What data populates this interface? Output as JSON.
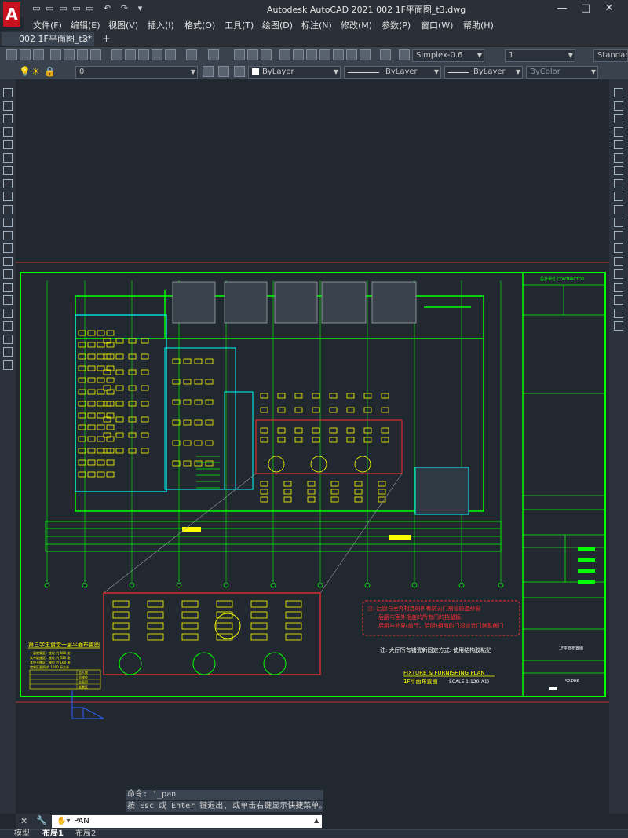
{
  "app": {
    "logo": "A",
    "title": "Autodesk AutoCAD 2021    002 1F平面图_t3.dwg"
  },
  "window_controls": {
    "minimize": "—",
    "maximize": "□",
    "close": "✕"
  },
  "menu": [
    "文件(F)",
    "编辑(E)",
    "视图(V)",
    "插入(I)",
    "格式(O)",
    "工具(T)",
    "绘图(D)",
    "标注(N)",
    "修改(M)",
    "参数(P)",
    "窗口(W)",
    "帮助(H)"
  ],
  "tabs": {
    "active": "002 1F平面图_t3*",
    "close": "×",
    "add": "+"
  },
  "toolbar": {
    "text_style": "Simplex-0.6",
    "text_height": "1",
    "dim_style": "Standard",
    "layer": "0",
    "color": "ByLayer",
    "linetype": "ByLayer",
    "lineweight": "ByLayer",
    "plotstyle": "ByColor"
  },
  "drawing": {
    "title_block_header": "設計單位 CONTRACTOR",
    "sheet_name": "1F平面布置图",
    "sheet_no": "SP-PH6",
    "note_red_1": "注: 后厨与室外相连的所有防火门需设防盗纱窗",
    "note_red_2": "后厨与室外相连的所有门的挡鼠板.",
    "note_red_3": "后厨与外界(前厅、后厨)相隔的门须设计门禁系统门",
    "note_white": "注: 大厅所有铺瓷新固定方式: 使用结构胶粘贴",
    "plan_title_en": "FIXTURE & FURNISHING PLAN",
    "plan_title_cn": "1F平面布置图",
    "plan_scale": "SCALE 1:120(A1)",
    "legend_title": "第三学生食堂一层平面布置图",
    "legend_rows": [
      "一层就餐区：座位 约 680 座",
      "其中散座区：座位 约 520 座",
      "其中卡座区：座位 约 160 座",
      "就餐区面积 约 1300 平方米"
    ],
    "legend_small": [
      "总人数",
      "总座位",
      "总面积",
      "就餐区"
    ]
  },
  "command": {
    "history": "命令: '_pan",
    "hint": "按 Esc 或 Enter 键退出, 或单击右键显示快捷菜单。",
    "input": "PAN",
    "cmd_icon": "✕",
    "wrench_icon": "🔧"
  },
  "layout_tabs": [
    "模型",
    "布局1",
    "布局2"
  ],
  "colors": {
    "accent": "#c8101e",
    "green": "#00ff00",
    "yellow": "#ffff00",
    "red": "#ff0000",
    "cyan": "#00ffff",
    "canvas": "#212830"
  }
}
